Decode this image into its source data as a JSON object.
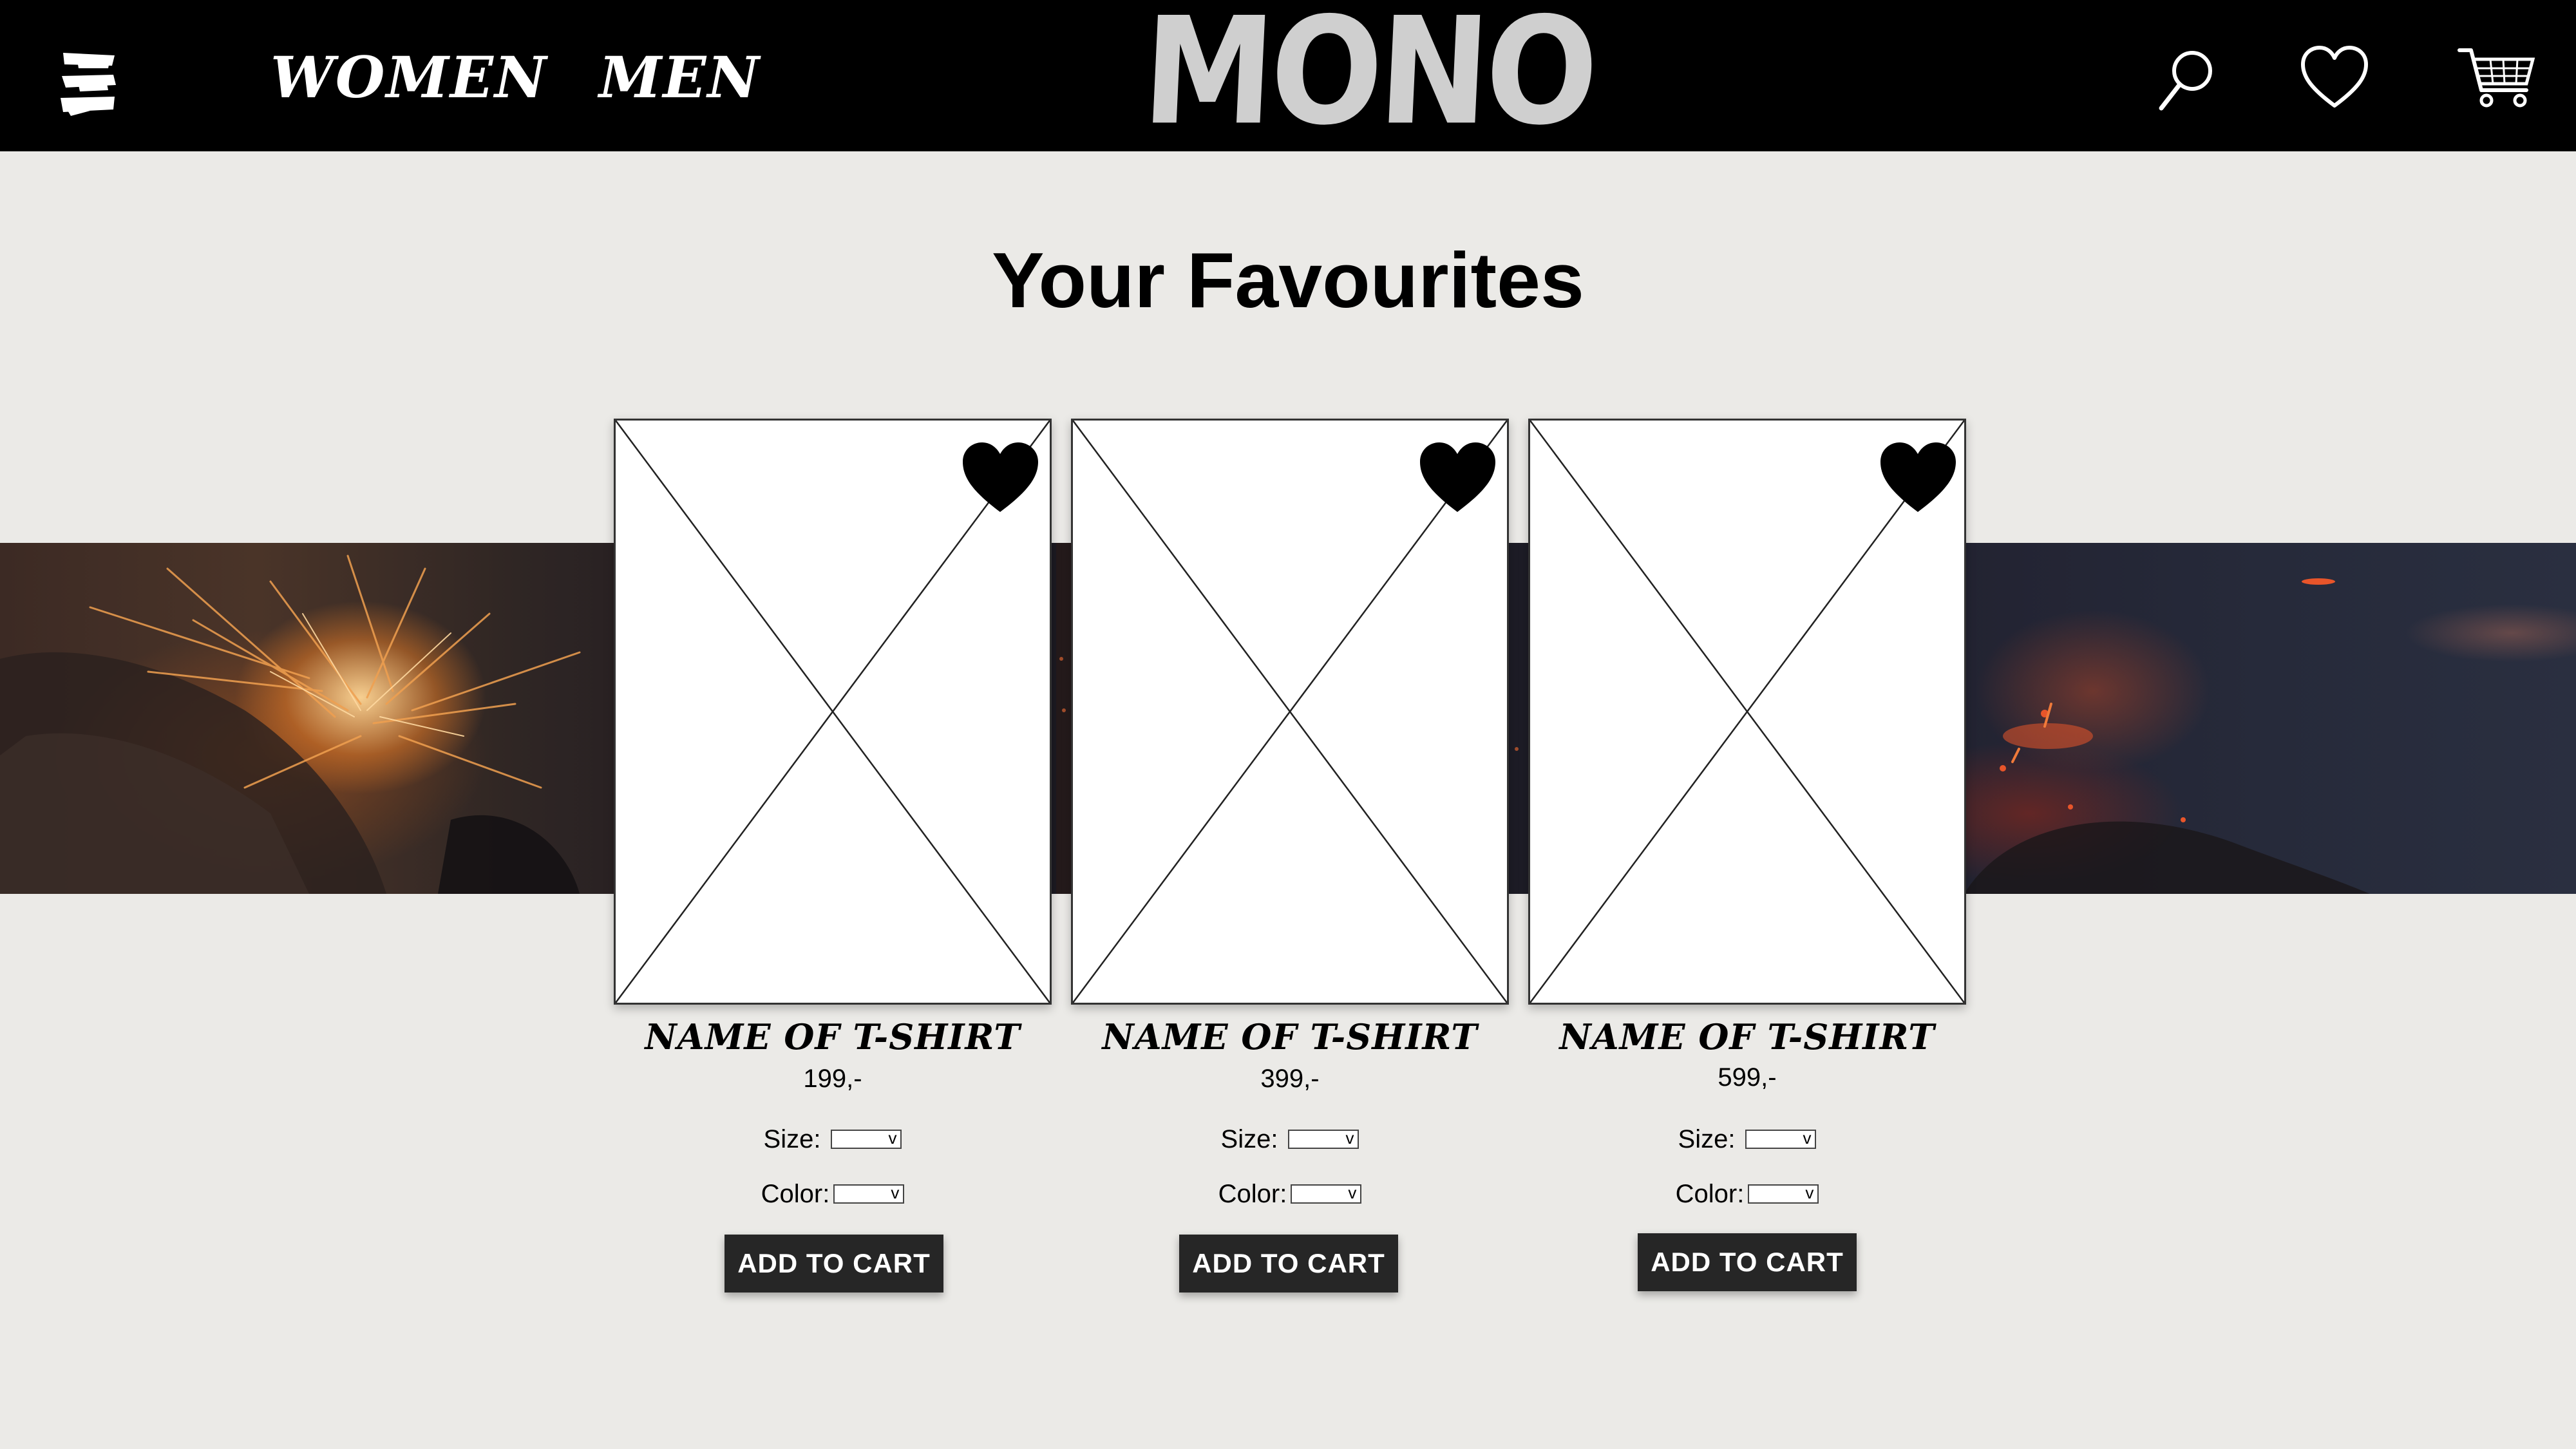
{
  "header": {
    "nav": {
      "women": "WOMEN",
      "men": "MEN"
    },
    "logo_text": "MONO",
    "icons": [
      "menu-icon",
      "search-icon",
      "heart-icon",
      "cart-icon"
    ]
  },
  "page": {
    "title": "Your Favourites"
  },
  "products": [
    {
      "name": "NAME OF T-SHIRT",
      "price": "199,-",
      "size_label": "Size:",
      "color_label": "Color:",
      "size_value": "",
      "color_value": "",
      "button": "ADD TO CART",
      "favourited": true
    },
    {
      "name": "NAME OF T-SHIRT",
      "price": "399,-",
      "size_label": "Size:",
      "color_label": "Color:",
      "size_value": "",
      "color_value": "",
      "button": "ADD TO CART",
      "favourited": true
    },
    {
      "name": "NAME OF T-SHIRT",
      "price": "599,-",
      "size_label": "Size:",
      "color_label": "Color:",
      "size_value": "",
      "color_value": "",
      "button": "ADD TO CART",
      "favourited": true
    }
  ],
  "colors": {
    "header_bg": "#000000",
    "page_bg": "#ebeae7",
    "button_bg": "#262626",
    "logo": "#cfcfcf"
  }
}
